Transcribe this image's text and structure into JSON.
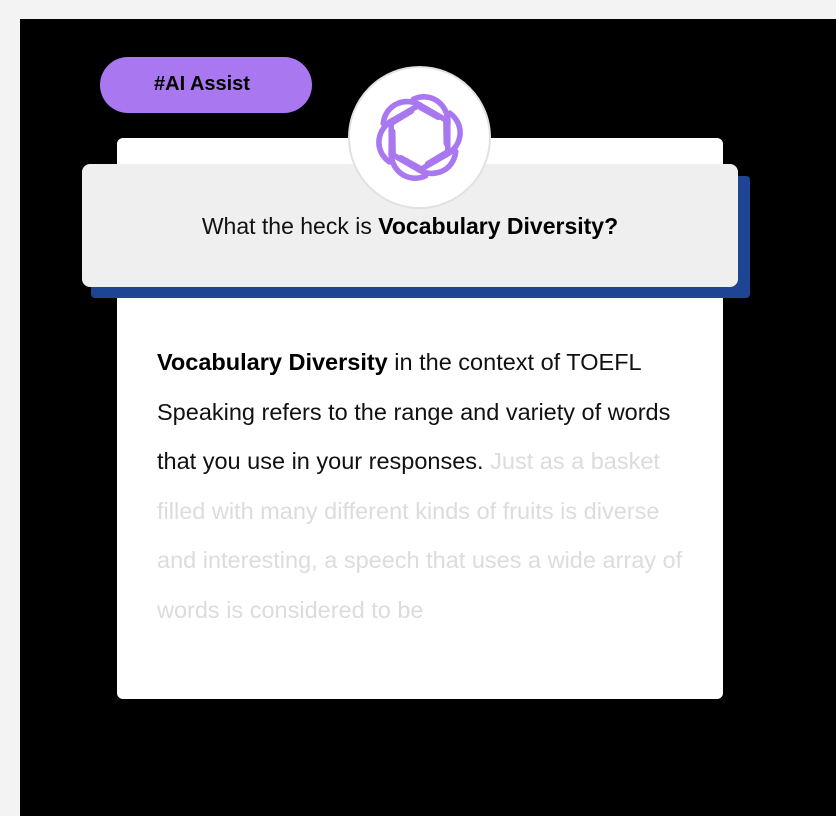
{
  "badge": {
    "label": "#AI Assist"
  },
  "logo": {
    "icon": "openai-knot-icon",
    "color": "#a978f0"
  },
  "question": {
    "prefix": "What the heck is ",
    "term": "Vocabulary Diversity?"
  },
  "answer": {
    "term": "Vocabulary Diversity",
    "body": " in the context of TOEFL Speaking refers to the range and variety of words that you use in your responses.",
    "faded": " Just as a basket filled with many different kinds of fruits is diverse and interesting, a speech that uses a wide array of words is considered to be"
  },
  "colors": {
    "background": "#000000",
    "badge": "#a978f0",
    "accent_shadow": "#1e4494",
    "question_bg": "#efefef",
    "faded_text": "#dcdcdc"
  }
}
